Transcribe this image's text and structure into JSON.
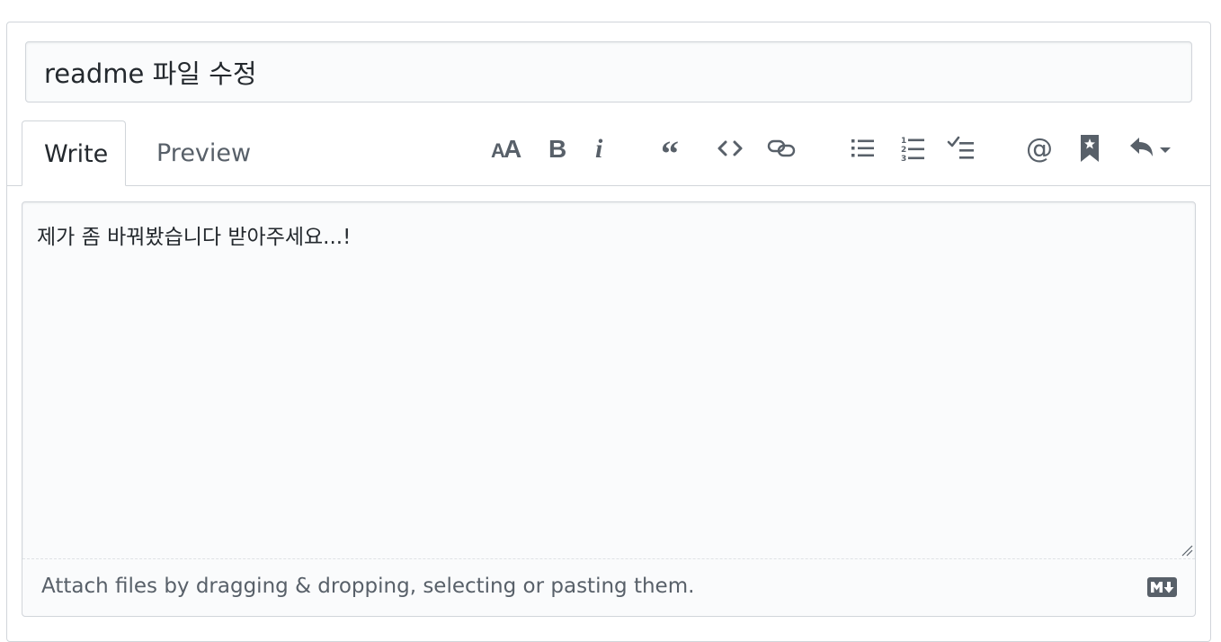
{
  "pr_title": {
    "value": "readme 파일 수정"
  },
  "tabs": {
    "write_label": "Write",
    "preview_label": "Preview"
  },
  "toolbar": {
    "buttons": [
      "text-size-icon",
      "bold-icon",
      "italic-icon",
      "quote-icon",
      "code-icon",
      "link-icon",
      "unordered-list-icon",
      "ordered-list-icon",
      "task-list-icon",
      "mention-icon",
      "saved-reply-bookmark-icon",
      "reply-icon"
    ]
  },
  "editor": {
    "body_value": "제가 좀 바꿔봤습니다 받아주세요...!",
    "attach_hint": "Attach files by dragging & dropping, selecting or pasting them.",
    "markdown_badge": "markdown-icon"
  },
  "colors": {
    "border": "#d1d5da",
    "field_bg": "#fafbfc",
    "icon": "#586069",
    "text": "#24292e"
  }
}
